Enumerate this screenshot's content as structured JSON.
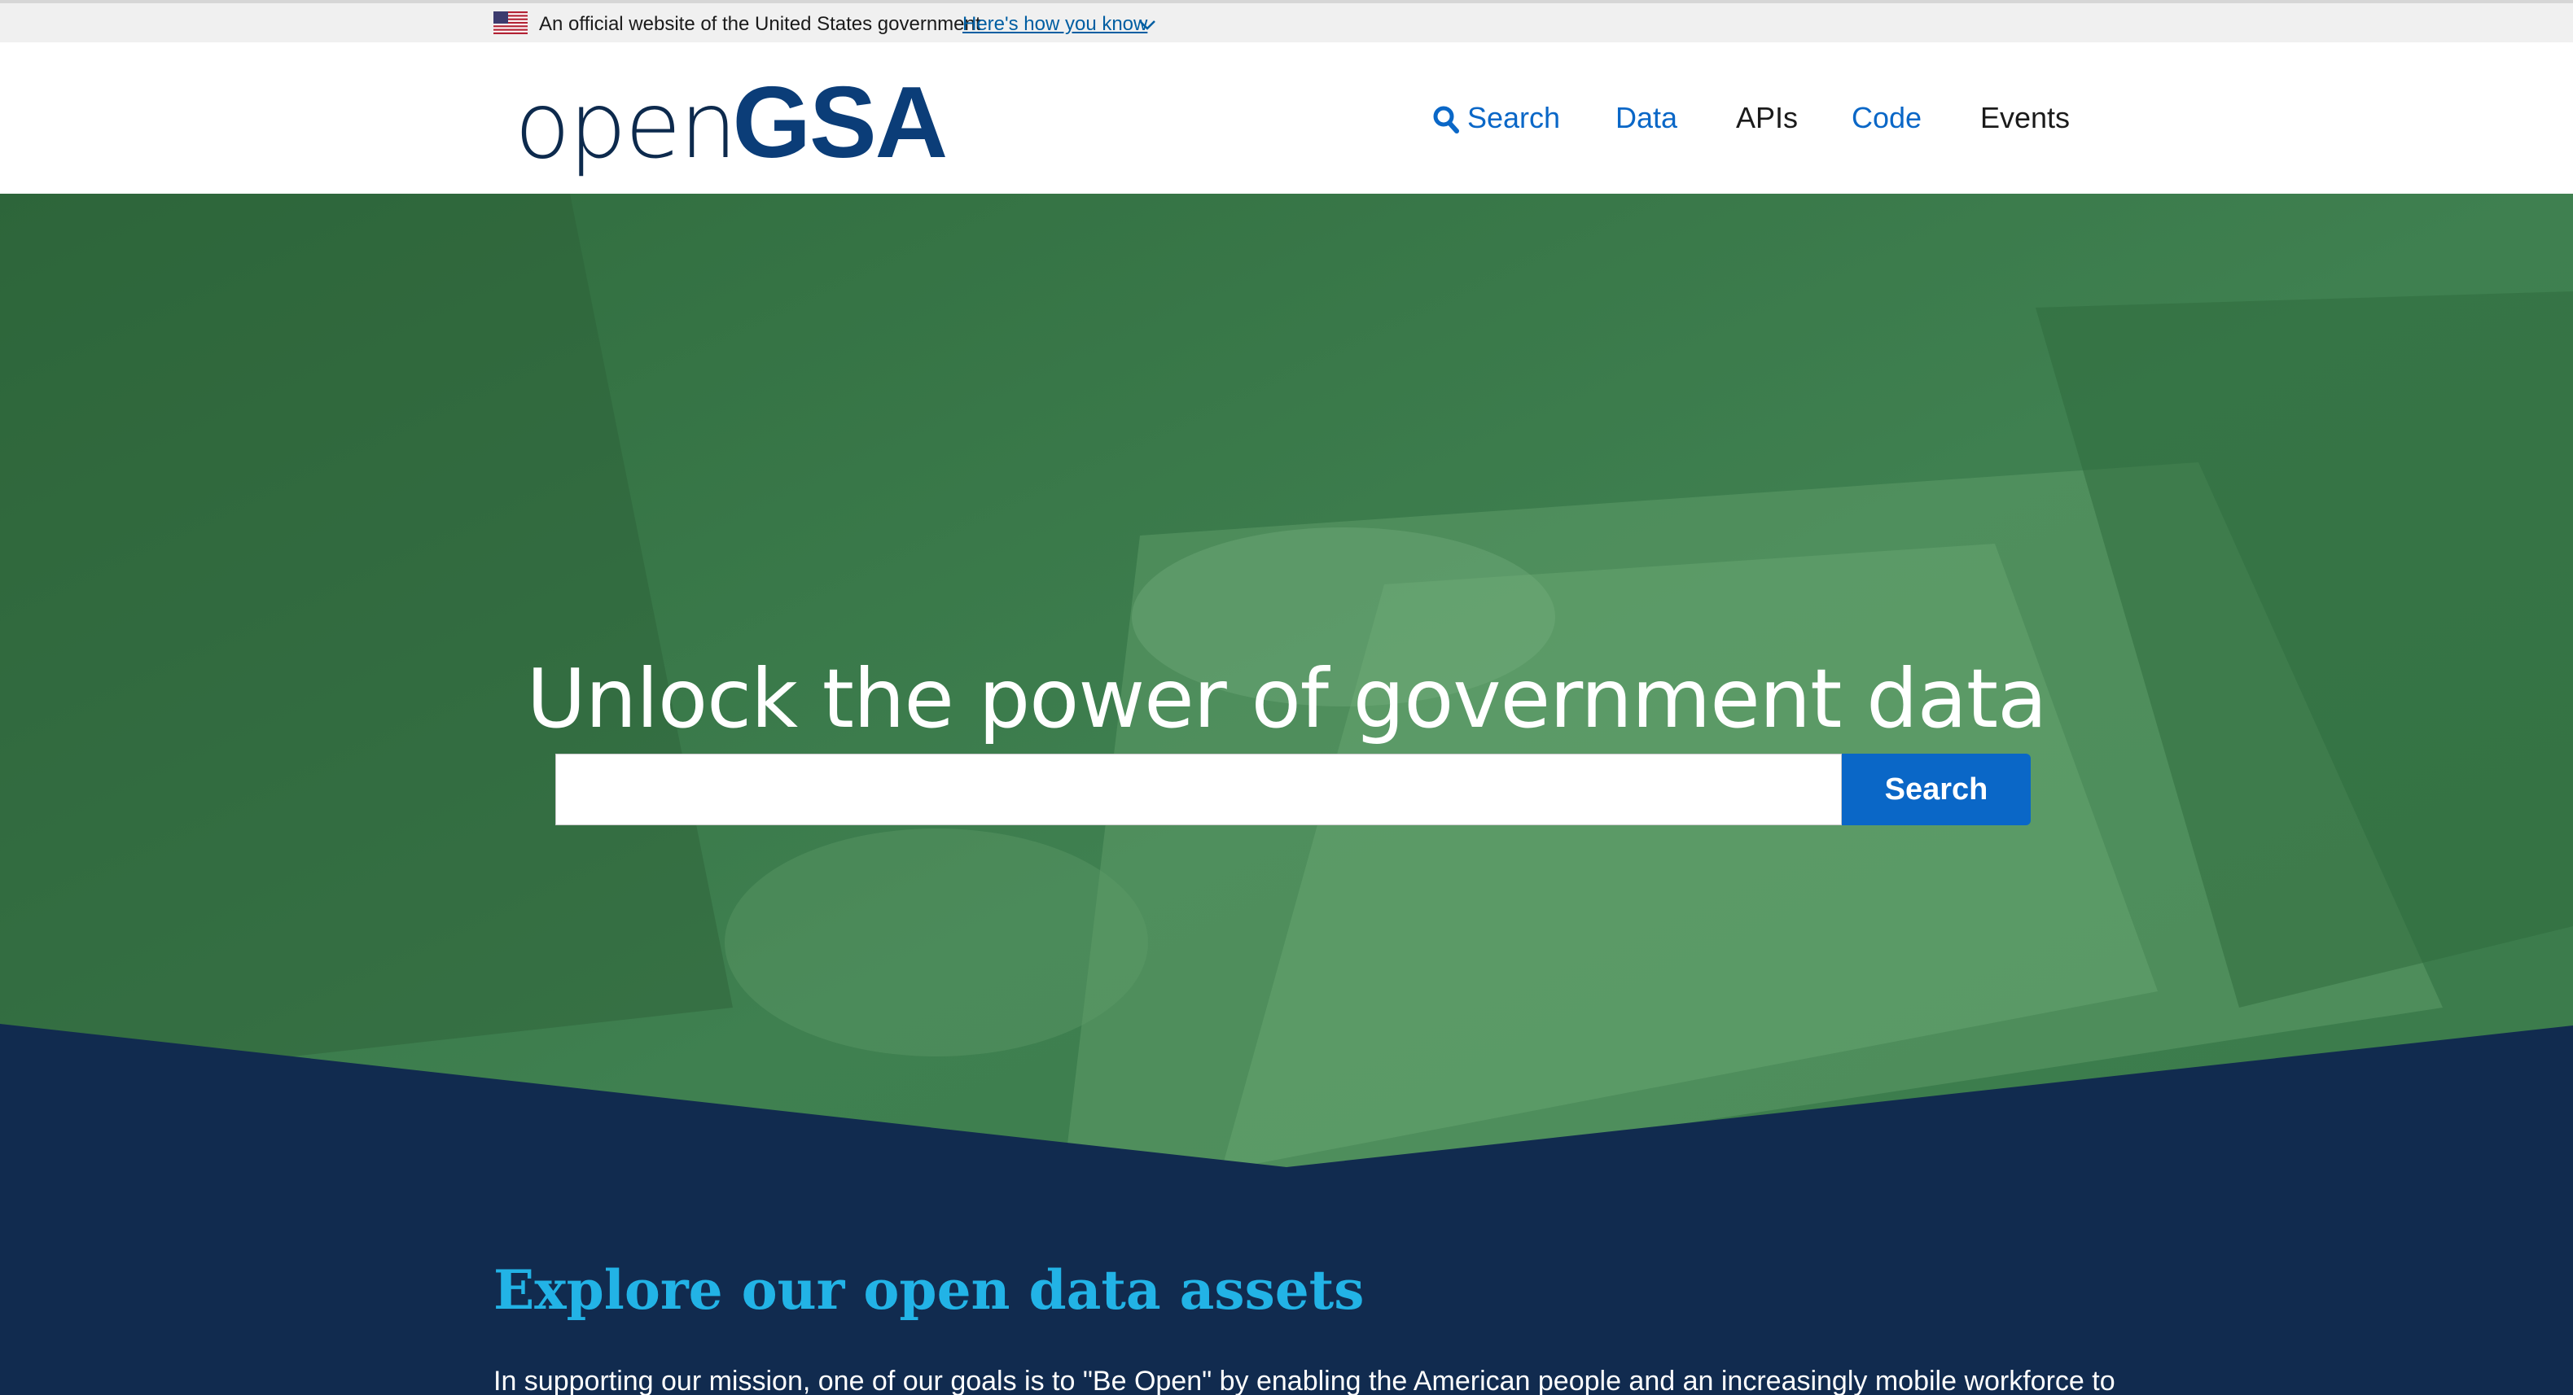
{
  "gov_banner": {
    "official_text": "An official website of the United States government",
    "how_you_know": "Here's how you know"
  },
  "header": {
    "logo_open": "open",
    "logo_gsa": "GSA",
    "nav": [
      {
        "label": "Search",
        "icon": "search-icon"
      },
      {
        "label": "Data"
      },
      {
        "label": "APIs"
      },
      {
        "label": "Code"
      },
      {
        "label": "Events"
      }
    ]
  },
  "hero": {
    "title": "Unlock the power of government data",
    "search_placeholder": "",
    "search_button": "Search"
  },
  "explore": {
    "title": "Explore our open data assets",
    "text": "In supporting our mission, one of our goals is to \"Be Open\" by enabling the American people and an increasingly mobile workforce to"
  },
  "colors": {
    "hero_green": "#3d7a4b",
    "navy": "#112b4f",
    "accent_blue": "#0a67c7",
    "cyan_heading": "#22b3e6"
  }
}
